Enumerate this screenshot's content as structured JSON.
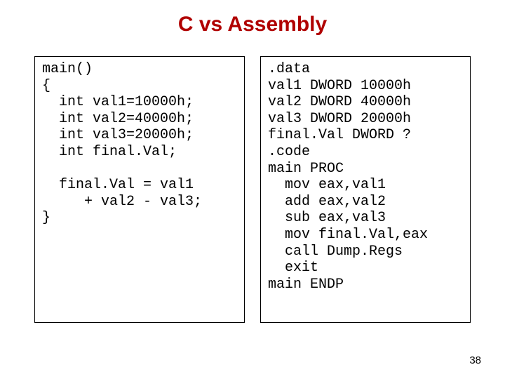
{
  "title": "C vs Assembly",
  "left_code": "main()\n{\n  int val1=10000h;\n  int val2=40000h;\n  int val3=20000h;\n  int final.Val;\n\n  final.Val = val1\n     + val2 - val3;\n}",
  "right_code": ".data\nval1 DWORD 10000h\nval2 DWORD 40000h\nval3 DWORD 20000h\nfinal.Val DWORD ?\n.code\nmain PROC\n  mov eax,val1\n  add eax,val2\n  sub eax,val3\n  mov final.Val,eax\n  call Dump.Regs\n  exit\nmain ENDP",
  "page_number": "38"
}
